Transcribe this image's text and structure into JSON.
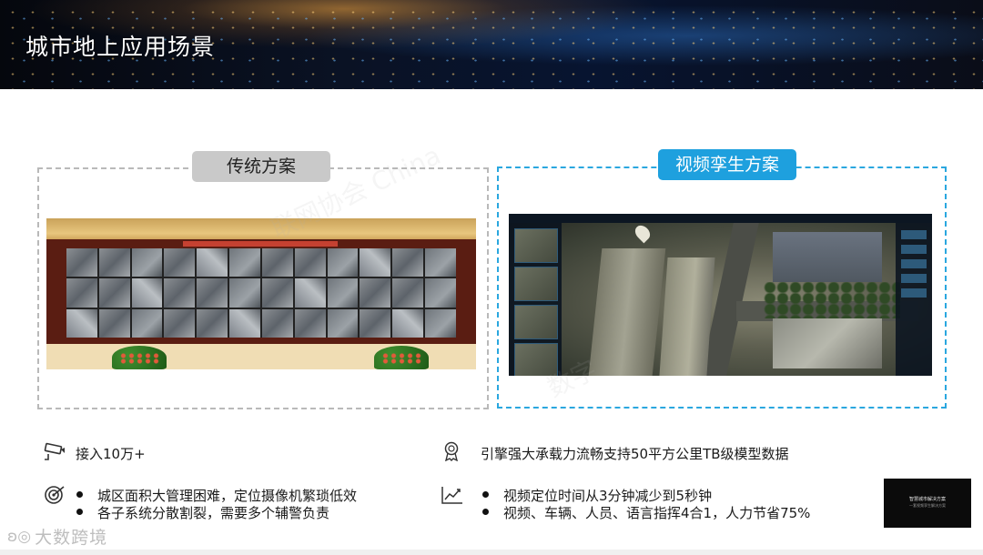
{
  "header": {
    "title": "城市地上应用场景"
  },
  "panels": {
    "traditional": {
      "label": "传统方案"
    },
    "twin": {
      "label": "视频孪生方案"
    }
  },
  "features_left": {
    "row1": {
      "icon": "cctv-camera-icon",
      "text": "接入10万+"
    },
    "row2": {
      "icon": "target-icon",
      "bullets": [
        "城区面积大管理困难，定位摄像机繁琐低效",
        "各子系统分散割裂，需要多个辅警负责"
      ]
    }
  },
  "features_right": {
    "row1": {
      "icon": "award-badge-icon",
      "text": "引擎强大承载力流畅支持50平方公里TB级模型数据"
    },
    "row2": {
      "icon": "trend-chart-icon",
      "bullets": [
        "视频定位时间从3分钟减少到5秒钟",
        "视频、车辆、人员、语言指挥4合1，人力节省75%"
      ]
    }
  },
  "thumbnail": {
    "line1": "智慧城市解决方案",
    "line2": "一套视频孪生解决方案"
  },
  "logo": {
    "icon": "kiwi-logo-icon",
    "text": "大数跨境"
  },
  "colors": {
    "twin_accent": "#1ea0de",
    "trad_tag": "#c9c9c9",
    "trad_border": "#b9b9b9",
    "twin_border": "#2aa7df"
  }
}
